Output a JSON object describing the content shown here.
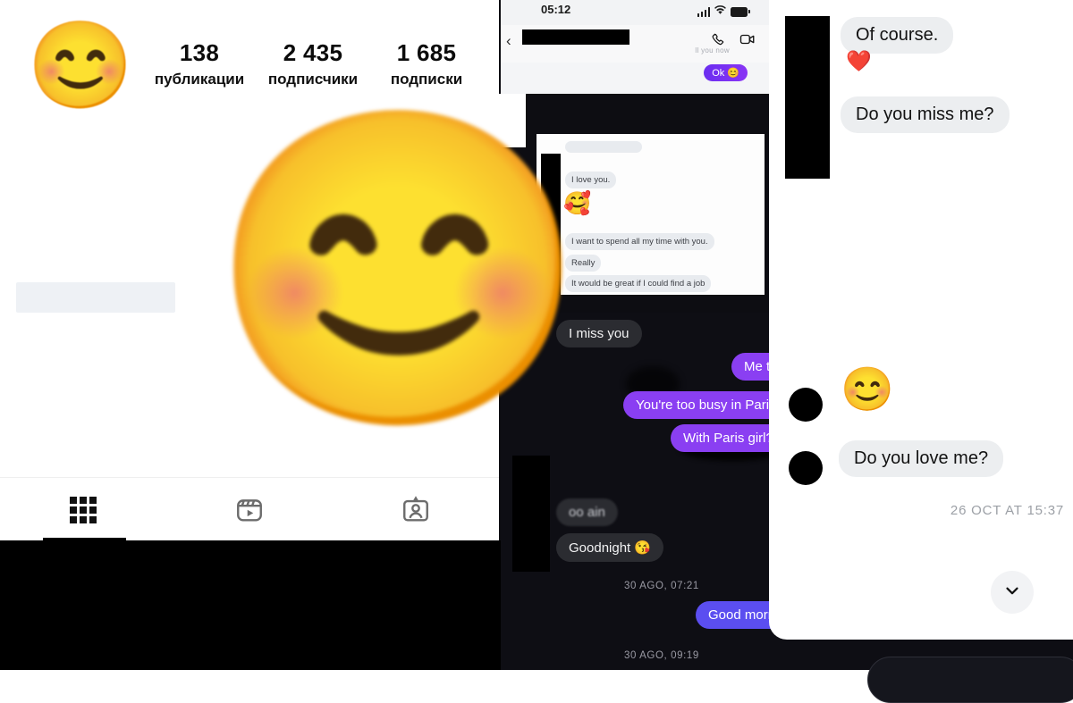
{
  "instagram_profile": {
    "avatar_emoji": "😊",
    "stats": [
      {
        "value": "138",
        "label": "публикации"
      },
      {
        "value": "2 435",
        "label": "подписчики"
      },
      {
        "value": "1 685",
        "label": "подписки"
      }
    ],
    "tabs": [
      {
        "icon": "grid-icon",
        "active": true
      },
      {
        "icon": "reels-icon",
        "active": false
      },
      {
        "icon": "tagged-icon",
        "active": false
      }
    ]
  },
  "messenger_top": {
    "status_time": "05:12",
    "back_label": "‹",
    "contact_name_redacted": "",
    "seen_text": "ll you now",
    "messages": [
      {
        "text": "Ok",
        "emoji": "😊",
        "side": "out"
      }
    ]
  },
  "messenger_middle": {
    "messages": [
      {
        "text": "I love you.",
        "side": "in"
      },
      {
        "text": "",
        "emoji": "🥰",
        "side": "in"
      },
      {
        "text": "I want to spend all my time with you.",
        "side": "in"
      },
      {
        "text": "Really",
        "side": "in"
      },
      {
        "text": "It would be great if I could find a job",
        "side": "in"
      }
    ]
  },
  "dark_chat": {
    "messages": [
      {
        "text": "I miss you",
        "side": "in"
      },
      {
        "text": "Me to",
        "side": "out"
      },
      {
        "text": "You're too busy in Paris",
        "side": "out"
      },
      {
        "text": "With Paris girl?",
        "side": "out"
      },
      {
        "text": "oo ain",
        "side": "in"
      },
      {
        "text": "Goodnight 😘",
        "side": "in"
      },
      {
        "text": "Good morn",
        "side": "out"
      }
    ],
    "timestamps": [
      "30 AGO, 07:21",
      "30 AGO, 09:19"
    ]
  },
  "right_chat": {
    "messages": [
      {
        "text": "Of course.",
        "side": "in"
      },
      {
        "text": "",
        "emoji": "❤️",
        "side": "in"
      },
      {
        "text": "Do you miss me?",
        "side": "in"
      },
      {
        "text": "",
        "emoji": "😊",
        "side": "in"
      },
      {
        "text": "Do you love me?",
        "side": "in"
      }
    ],
    "timestamp": "26 OCT AT 15:37",
    "scroll_button_icon": "chevron-down-icon"
  },
  "colors": {
    "instagram_bg": "#ffffff",
    "dark_chat_bg": "#0e0e14",
    "bubble_incoming_dark": "#2b2c31",
    "bubble_outgoing_purple": "#8a3ff2",
    "bubble_outgoing_blue": "#5b4ef0",
    "bubble_incoming_light": "#eceef0",
    "accent_purple": "#7b2ff7",
    "redaction_black": "#000000"
  }
}
